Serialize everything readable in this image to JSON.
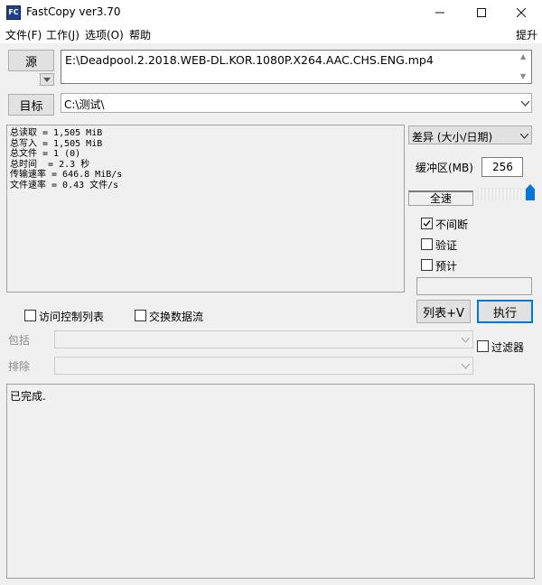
{
  "window": {
    "title": "FastCopy ver3.70",
    "icon_text": "FC"
  },
  "menu": {
    "file": "文件(F)",
    "work": "工作(J)",
    "options": "选项(O)",
    "help": "帮助",
    "raise": "提升"
  },
  "source": {
    "button": "源",
    "path": "E:\\Deadpool.2.2018.WEB-DL.KOR.1080P.X264.AAC.CHS.ENG.mp4"
  },
  "target": {
    "button": "目标",
    "path": "C:\\测试\\"
  },
  "stats": {
    "lines": [
      "总读取 = 1,505 MiB",
      "总写入 = 1,505 MiB",
      "总文件 = 1 (0)",
      "总时间  = 2.3 秒",
      "传输速率 = 646.8 MiB/s",
      "文件速率 = 0.43 文件/s"
    ]
  },
  "options": {
    "mode": "差异 (大小/日期)",
    "buffer_label": "缓冲区(MB)",
    "buffer_value": "256",
    "speed_label": "全速",
    "speed_level": 1.0,
    "nonstop": "不间断",
    "nonstop_checked": true,
    "verify": "验证",
    "verify_checked": false,
    "estimate": "预计",
    "estimate_checked": false
  },
  "actions": {
    "list": "列表+V",
    "execute": "执行"
  },
  "extras": {
    "acl": "访问控制列表",
    "stream": "交换数据流",
    "filter": "过滤器"
  },
  "filters": {
    "include_label": "包括",
    "exclude_label": "排除"
  },
  "log": {
    "text": "已完成."
  },
  "colors": {
    "accent": "#0078d7",
    "background": "#f0f0f0"
  }
}
